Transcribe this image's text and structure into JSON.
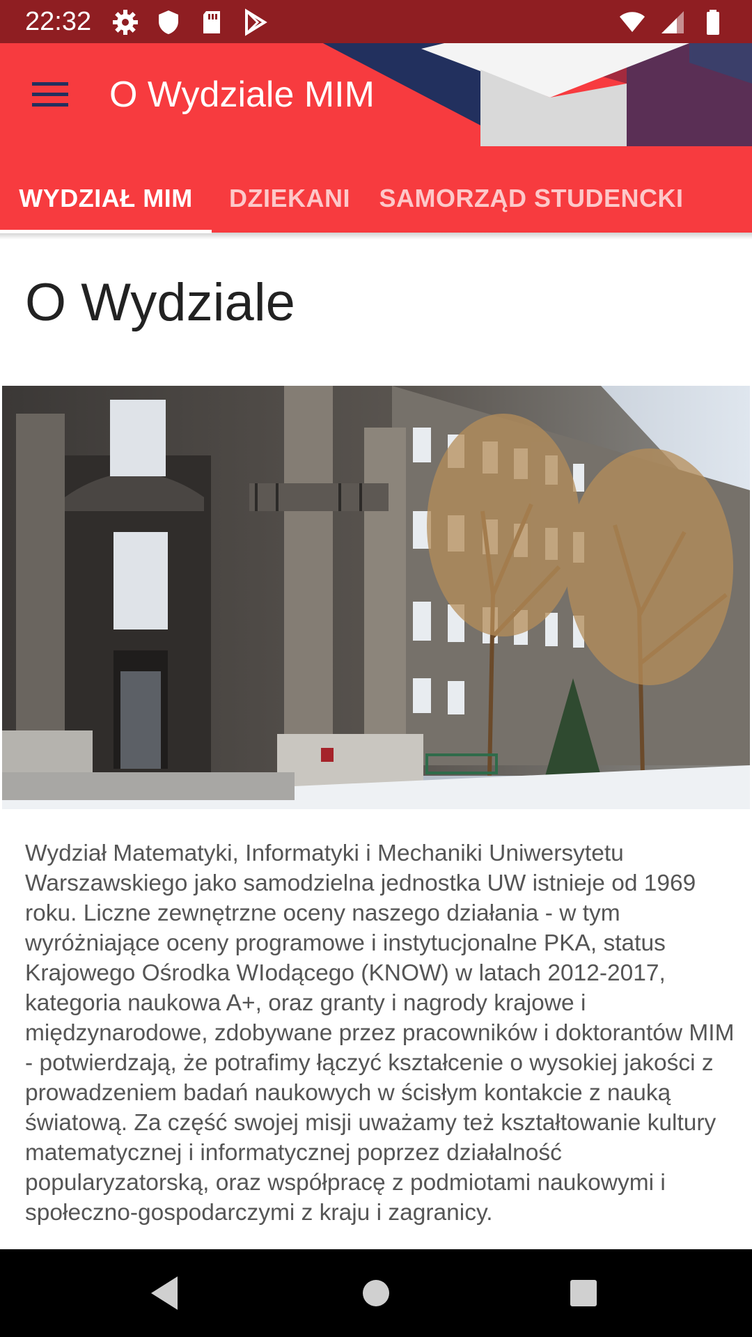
{
  "status_bar": {
    "time": "22:32",
    "left_icons": [
      "gear-icon",
      "shield-icon",
      "sd-card-icon",
      "play-store-icon"
    ],
    "right_icons": [
      "wifi-icon",
      "signal-icon",
      "battery-icon"
    ]
  },
  "app_bar": {
    "title": "O Wydziale MIM",
    "menu_icon": "hamburger-menu-icon",
    "colors": {
      "primary": "#f73b3f",
      "status": "#8f1e22",
      "navy": "#22305e"
    }
  },
  "tabs": [
    {
      "label": "WYDZIAŁ MIM",
      "active": true
    },
    {
      "label": "DZIEKANI",
      "active": false
    },
    {
      "label": "SAMORZĄD STUDENCKI",
      "active": false
    }
  ],
  "content": {
    "heading": "O Wydziale",
    "body": "Wydział Matematyki, Informatyki i Mechaniki Uniwersytetu Warszawskiego jako samodzielna jednostka UW istnieje od 1969 roku. Liczne zewnętrzne oceny naszego działania - w tym wyróżniające oceny programowe i instytucjonalne PKA, status Krajowego Ośrodka WIodącego (KNOW) w latach 2012-2017, kategoria naukowa A+, oraz granty i nagrody krajowe i międzynarodowe, zdobywane przez pracowników i doktorantów MIM - potwierdzają, że potrafimy łączyć kształcenie o wysokiej jakości z prowadzeniem badań naukowych w ścisłym kontakcie z nauką światową. Za część swojej misji uważamy też kształtowanie kultury matematycznej i informatycznej poprzez działalność popularyzatorską, oraz współpracę z podmiotami naukowymi i społeczno-gospodarczymi z kraju i zagranicy."
  },
  "nav_bar": {
    "buttons": [
      "back-icon",
      "home-icon",
      "recents-icon"
    ]
  }
}
